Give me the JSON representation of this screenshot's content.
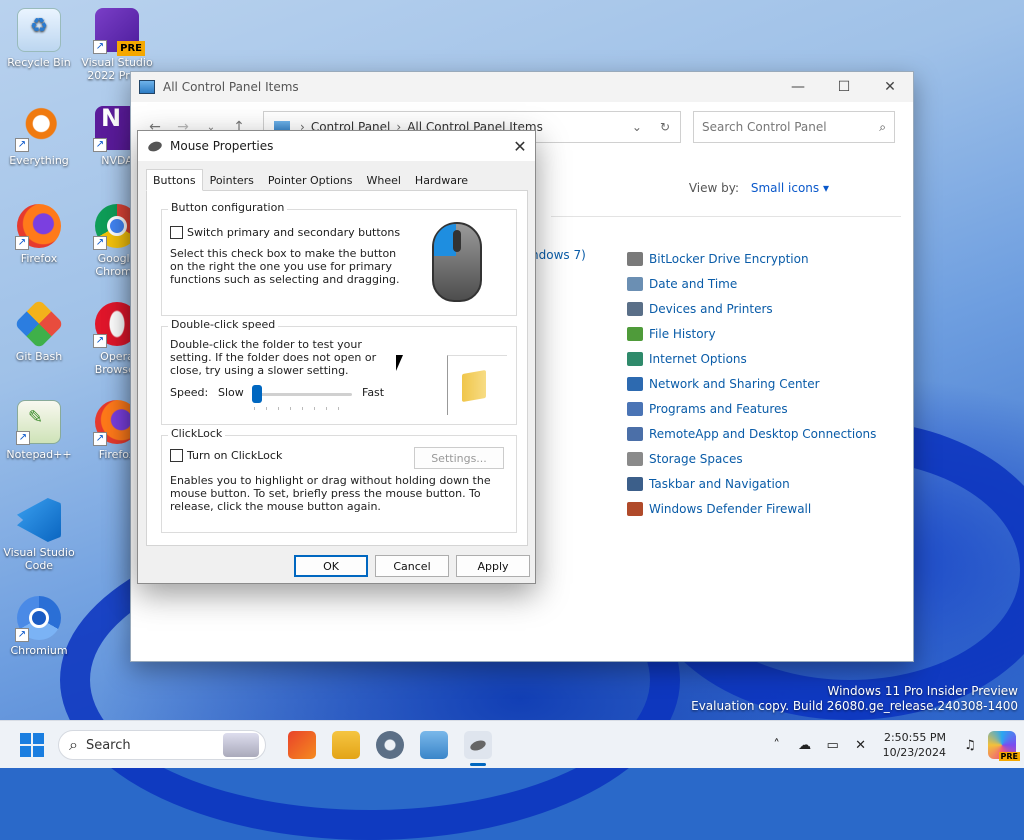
{
  "desktop": {
    "icons": [
      {
        "label": "Recycle Bin"
      },
      {
        "label": "Visual Studio 2022 Pre..."
      },
      {
        "label": "Everything"
      },
      {
        "label": "NVDA"
      },
      {
        "label": "Firefox"
      },
      {
        "label": "Google Chrome"
      },
      {
        "label": "Git Bash"
      },
      {
        "label": "Opera Browser"
      },
      {
        "label": "Notepad++"
      },
      {
        "label": "Firefox"
      },
      {
        "label": "Visual Studio Code"
      },
      {
        "label": "Chromium"
      }
    ],
    "pre_badge": "PRE",
    "watermark_line1": "Windows 11 Pro Insider Preview",
    "watermark_line2": "Evaluation copy. Build 26080.ge_release.240308-1400"
  },
  "control_panel": {
    "title": "All Control Panel Items",
    "breadcrumb": [
      "Control Panel",
      "All Control Panel Items"
    ],
    "search_placeholder": "Search Control Panel",
    "view_by_label": "View by:",
    "view_by_value": "Small icons",
    "partial_item": "ndows 7)",
    "items": [
      {
        "label": "BitLocker Drive Encryption",
        "color": "#7a7a7a"
      },
      {
        "label": "Date and Time",
        "color": "#6b8fb3"
      },
      {
        "label": "Devices and Printers",
        "color": "#5a6f88"
      },
      {
        "label": "File History",
        "color": "#4f9b3a"
      },
      {
        "label": "Internet Options",
        "color": "#2f8a6b"
      },
      {
        "label": "Network and Sharing Center",
        "color": "#2d6ab0"
      },
      {
        "label": "Programs and Features",
        "color": "#4a74b5"
      },
      {
        "label": "RemoteApp and Desktop Connections",
        "color": "#4b6fa8"
      },
      {
        "label": "Storage Spaces",
        "color": "#8a8a8a"
      },
      {
        "label": "Taskbar and Navigation",
        "color": "#3c5f8a"
      },
      {
        "label": "Windows Defender Firewall",
        "color": "#b04a2a"
      }
    ]
  },
  "mouse_dialog": {
    "title": "Mouse Properties",
    "tabs": [
      "Buttons",
      "Pointers",
      "Pointer Options",
      "Wheel",
      "Hardware"
    ],
    "active_tab": "Buttons",
    "button_config": {
      "legend": "Button configuration",
      "checkbox_label": "Switch primary and secondary buttons",
      "description": "Select this check box to make the button on the right the one you use for primary functions such as selecting and dragging."
    },
    "double_click": {
      "legend": "Double-click speed",
      "description": "Double-click the folder to test your setting. If the folder does not open or close, try using a slower setting.",
      "speed_label": "Speed:",
      "slow_label": "Slow",
      "fast_label": "Fast",
      "slider_value": 0.0
    },
    "clicklock": {
      "legend": "ClickLock",
      "checkbox_label": "Turn on ClickLock",
      "settings_button": "Settings...",
      "description": "Enables you to highlight or drag without holding down the mouse button. To set, briefly press the mouse button. To release, click the mouse button again."
    },
    "buttons": {
      "ok": "OK",
      "cancel": "Cancel",
      "apply": "Apply"
    }
  },
  "taskbar": {
    "search_label": "Search",
    "time": "2:50:55 PM",
    "date": "10/23/2024",
    "pre_badge": "PRE"
  }
}
